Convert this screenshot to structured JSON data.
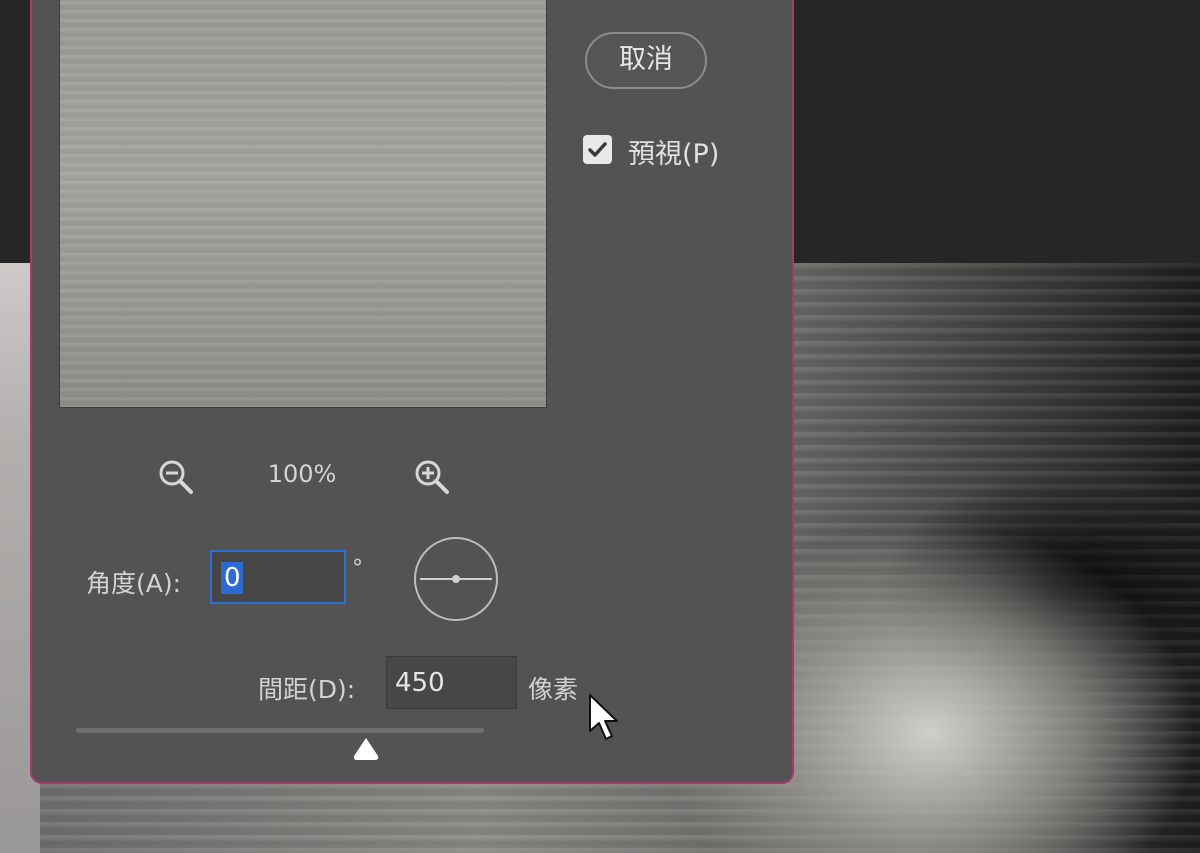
{
  "dialog": {
    "zoom_level": "100%",
    "buttons": {
      "cancel": "取消"
    },
    "preview_option": {
      "label": "預視(P)",
      "checked": true
    },
    "angle": {
      "label": "角度(A):",
      "value": "0",
      "unit": "°"
    },
    "distance": {
      "label": "間距(D):",
      "value": "450",
      "unit": "像素",
      "slider_level": 0.71
    }
  },
  "icons": {
    "zoom_out": "zoom-out-icon",
    "zoom_in": "zoom-in-icon",
    "checkbox": "checkmark-icon",
    "angle_dial": "angle-dial-icon",
    "slider_thumb": "triangle-slider-thumb-icon",
    "cursor": "mouse-pointer-icon"
  },
  "colors": {
    "dialog_bg": "#535353",
    "dialog_border": "#a23a6b",
    "focus_blue": "#2f6ed2"
  }
}
